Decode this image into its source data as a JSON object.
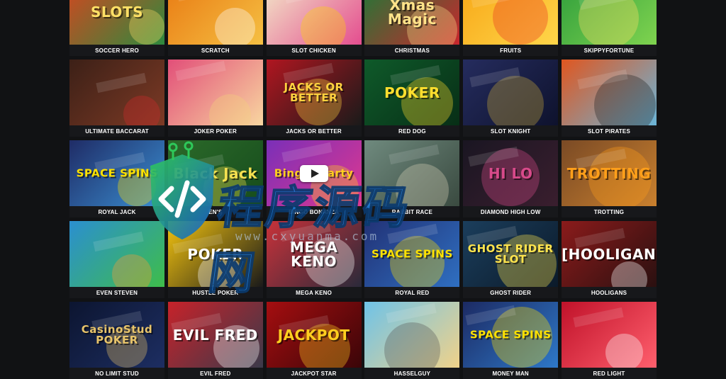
{
  "games": [
    {
      "label": "SOCCER HERO",
      "thumb_text": "SLOTS",
      "bg": "#d4461f",
      "bg2": "#2d8a3e",
      "accent": "#ffe066"
    },
    {
      "label": "SCRATCH",
      "thumb_text": "",
      "bg": "#e97a13",
      "bg2": "#f5c043",
      "accent": "#ffffff"
    },
    {
      "label": "SLOT CHICKEN",
      "thumb_text": "",
      "bg": "#f3e9c9",
      "bg2": "#e44d8f",
      "accent": "#ffd400"
    },
    {
      "label": "CHRISTMAS",
      "thumb_text": "Xmas Magic",
      "bg": "#1c7a37",
      "bg2": "#c9262d",
      "accent": "#ffe38a"
    },
    {
      "label": "FRUITS",
      "thumb_text": "",
      "bg": "#f7a717",
      "bg2": "#ffd64a",
      "accent": "#e8321f"
    },
    {
      "label": "SKIPPYFORTUNE",
      "thumb_text": "",
      "bg": "#2f9e3c",
      "bg2": "#7fd34f",
      "accent": "#ffe066"
    },
    {
      "label": "ULTIMATE BACCARAT",
      "thumb_text": "",
      "bg": "#3c2017",
      "bg2": "#7d3a25",
      "accent": "#d02a2a"
    },
    {
      "label": "JOKER POKER",
      "thumb_text": "",
      "bg": "#e24f79",
      "bg2": "#f8d6a0",
      "accent": "#f4d27a"
    },
    {
      "label": "JACKS OR BETTER",
      "thumb_text": "JACKS OR BETTER",
      "bg": "#b01620",
      "bg2": "#1a1a1a",
      "accent": "#ffd23f"
    },
    {
      "label": "RED DOG",
      "thumb_text": "POKER",
      "bg": "#0f5a2a",
      "bg2": "#072e16",
      "accent": "#ffde2e"
    },
    {
      "label": "SLOT KNIGHT",
      "thumb_text": "",
      "bg": "#252c5e",
      "bg2": "#0e122d",
      "accent": "#c9a83a"
    },
    {
      "label": "SLOT PIRATES",
      "thumb_text": "",
      "bg": "#e0561f",
      "bg2": "#6ab5d8",
      "accent": "#222222"
    },
    {
      "label": "ROYAL JACK",
      "thumb_text": "SPACE SPINS",
      "bg": "#1f2c66",
      "bg2": "#3a8ed1",
      "accent": "#ffe200"
    },
    {
      "label": "EN'S",
      "thumb_text": "Black Jack",
      "bg": "#2c6a2a",
      "bg2": "#164c1c",
      "accent": "#f4e050"
    },
    {
      "label": "BINGO BONANZA",
      "thumb_text": "Bingo! party",
      "bg": "#7a2fb8",
      "bg2": "#e0388f",
      "accent": "#ffcf1f"
    },
    {
      "label": "RABBIT RACE",
      "thumb_text": "",
      "bg": "#6f8a7e",
      "bg2": "#3a4a40",
      "accent": "#d8d0b8"
    },
    {
      "label": "DIAMOND HIGH LOW",
      "thumb_text": "HI LO",
      "bg": "#1a1622",
      "bg2": "#3a1e2e",
      "accent": "#d84a8a"
    },
    {
      "label": "TROTTING",
      "thumb_text": "TROTTING",
      "bg": "#7a4a25",
      "bg2": "#c9802e",
      "accent": "#ff9f1a"
    },
    {
      "label": "EVEN STEVEN",
      "thumb_text": "",
      "bg": "#2b8fd0",
      "bg2": "#3ebd4a",
      "accent": "#ff9c33"
    },
    {
      "label": "HUSTLE POKER",
      "thumb_text": "POKER",
      "bg": "#f2c20f",
      "bg2": "#1a1a1a",
      "accent": "#ffffff"
    },
    {
      "label": "MEGA KENO",
      "thumb_text": "MEGA KENO",
      "bg": "#c8323a",
      "bg2": "#2a2a3a",
      "accent": "#ffffff"
    },
    {
      "label": "ROYAL RED",
      "thumb_text": "SPACE SPINS",
      "bg": "#223276",
      "bg2": "#2f6fc1",
      "accent": "#ffe200"
    },
    {
      "label": "GHOST RIDER",
      "thumb_text": "GHOST RIDER SLOT",
      "bg": "#1b3e5c",
      "bg2": "#0b1a2a",
      "accent": "#ffe44d"
    },
    {
      "label": "HOOLIGANS",
      "thumb_text": "[HOOLIGAN]",
      "bg": "#8b1b1b",
      "bg2": "#2a1010",
      "accent": "#ffffff"
    },
    {
      "label": "NO LIMIT STUD",
      "thumb_text": "CasinoStud POKER",
      "bg": "#0c1530",
      "bg2": "#1d2e62",
      "accent": "#e8c46a"
    },
    {
      "label": "EVIL FRED",
      "thumb_text": "EVIL FRED",
      "bg": "#c7222a",
      "bg2": "#3a3a4a",
      "accent": "#ffffff"
    },
    {
      "label": "JACKPOT STAR",
      "thumb_text": "JACKPOT",
      "bg": "#a50e10",
      "bg2": "#3a0508",
      "accent": "#ffcf1f"
    },
    {
      "label": "HASSELGUY",
      "thumb_text": "",
      "bg": "#6fc3e8",
      "bg2": "#f0d28a",
      "accent": "#555555"
    },
    {
      "label": "MONEY MAN",
      "thumb_text": "SPACE SPINS",
      "bg": "#1c2a63",
      "bg2": "#2e78c8",
      "accent": "#ffe200"
    },
    {
      "label": "RED LIGHT",
      "thumb_text": "",
      "bg": "#c0122a",
      "bg2": "#ff5f6d",
      "accent": "#ffffff"
    }
  ],
  "watermark": {
    "title": "程序源码网",
    "url": "www.cxyuanma.com"
  }
}
